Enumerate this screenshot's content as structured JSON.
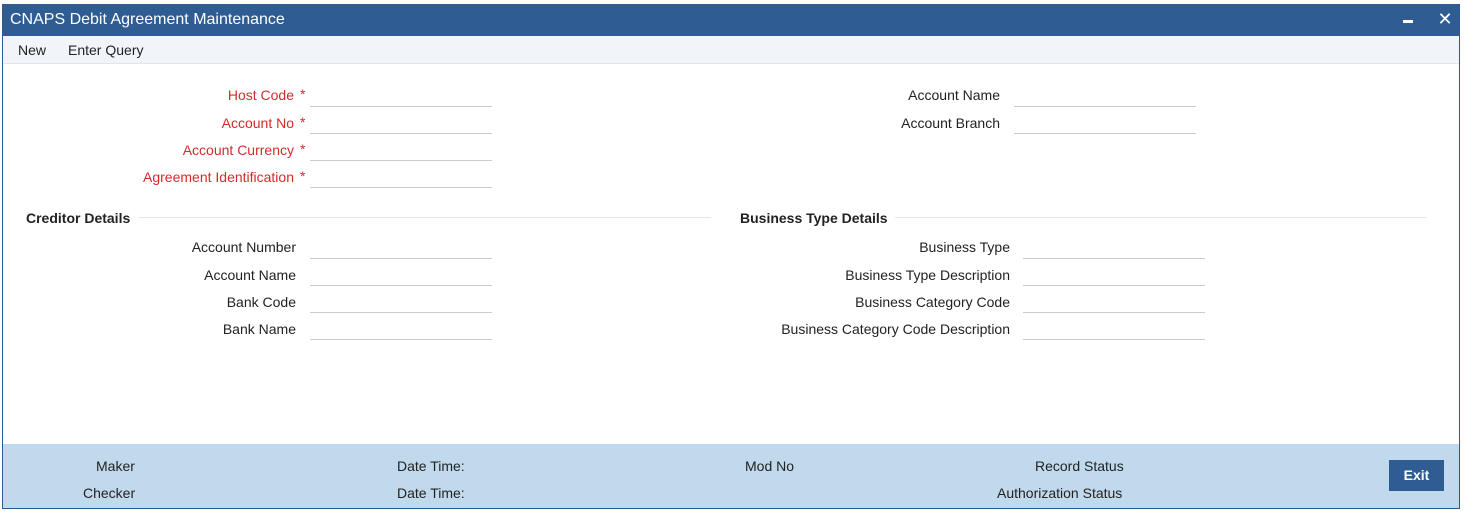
{
  "window": {
    "title": "CNAPS Debit Agreement Maintenance"
  },
  "menu": {
    "new": "New",
    "enter_query": "Enter Query"
  },
  "header_fields": {
    "host_code": {
      "label": "Host Code",
      "required": "*",
      "value": ""
    },
    "account_no": {
      "label": "Account No",
      "required": "*",
      "value": ""
    },
    "account_currency": {
      "label": "Account Currency",
      "required": "*",
      "value": ""
    },
    "agreement_identification": {
      "label": "Agreement Identification",
      "required": "*",
      "value": ""
    },
    "account_name": {
      "label": "Account Name",
      "value": ""
    },
    "account_branch": {
      "label": "Account Branch",
      "value": ""
    }
  },
  "creditor_details": {
    "title": "Creditor Details",
    "account_number": {
      "label": "Account Number",
      "value": ""
    },
    "account_name": {
      "label": "Account Name",
      "value": ""
    },
    "bank_code": {
      "label": "Bank Code",
      "value": ""
    },
    "bank_name": {
      "label": "Bank Name",
      "value": ""
    }
  },
  "business_type_details": {
    "title": "Business Type Details",
    "business_type": {
      "label": "Business Type",
      "value": ""
    },
    "business_type_description": {
      "label": "Business Type Description",
      "value": ""
    },
    "business_category_code": {
      "label": "Business Category Code",
      "value": ""
    },
    "business_category_code_description": {
      "label": "Business Category Code Description",
      "value": ""
    }
  },
  "footer": {
    "maker": "Maker",
    "checker": "Checker",
    "date_time_1": "Date Time:",
    "date_time_2": "Date Time:",
    "mod_no": "Mod No",
    "record_status": "Record Status",
    "authorization_status": "Authorization Status",
    "exit": "Exit"
  },
  "colors": {
    "title_bar": "#2e5c93",
    "required_label": "#d52a2a",
    "footer_bg": "#c0d9ec",
    "exit_button": "#2e5c93"
  },
  "icons": {
    "minimize": "minimize-icon",
    "close": "close-icon"
  }
}
